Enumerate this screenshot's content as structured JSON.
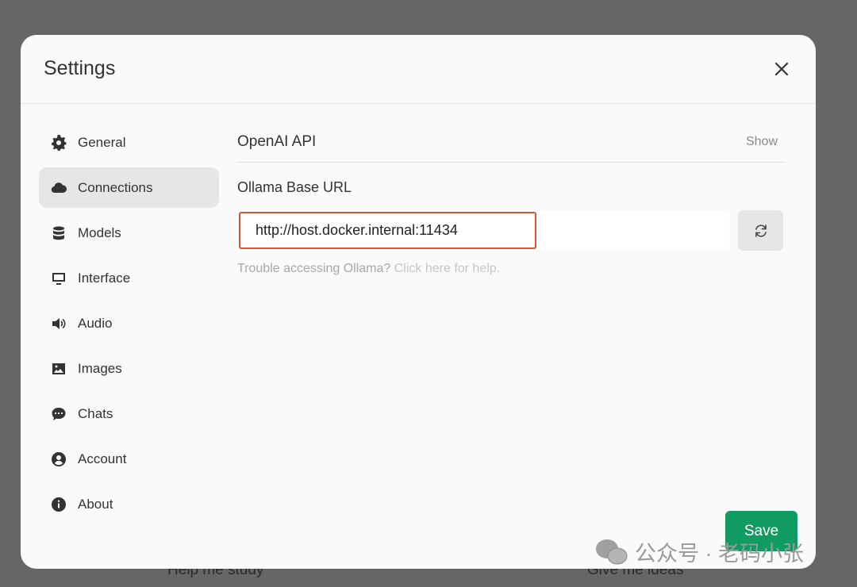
{
  "background": {
    "left_text": "Help me study",
    "right_text": "Give me ideas"
  },
  "modal": {
    "title": "Settings",
    "close_icon": "close-icon"
  },
  "sidebar": {
    "items": [
      {
        "label": "General",
        "icon": "gear-icon"
      },
      {
        "label": "Connections",
        "icon": "cloud-icon",
        "active": true
      },
      {
        "label": "Models",
        "icon": "database-icon"
      },
      {
        "label": "Interface",
        "icon": "monitor-icon"
      },
      {
        "label": "Audio",
        "icon": "speaker-icon"
      },
      {
        "label": "Images",
        "icon": "image-icon"
      },
      {
        "label": "Chats",
        "icon": "chat-icon"
      },
      {
        "label": "Account",
        "icon": "user-icon"
      },
      {
        "label": "About",
        "icon": "info-icon"
      }
    ]
  },
  "connections": {
    "openai_title": "OpenAI API",
    "show_label": "Show",
    "ollama_label": "Ollama Base URL",
    "ollama_url": "http://host.docker.internal:11434",
    "help_text": "Trouble accessing Ollama?",
    "help_link": "Click here for help."
  },
  "save_label": "Save",
  "watermark": "公众号 · 老码小张",
  "colors": {
    "accent": "#129a63",
    "highlight": "#d4553a"
  }
}
